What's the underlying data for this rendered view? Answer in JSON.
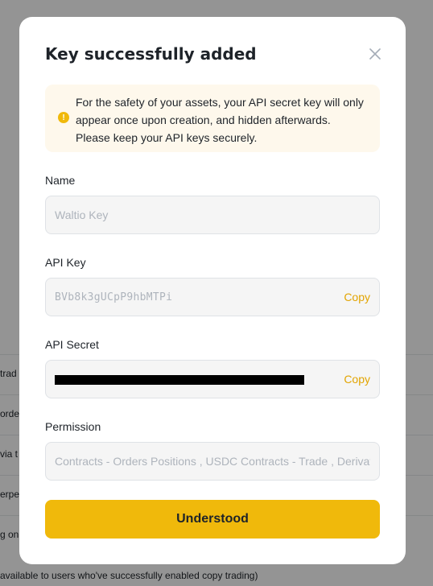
{
  "background": {
    "rows": [
      {
        "text": "trad"
      },
      {
        "text": "order"
      },
      {
        "text": "via t"
      },
      {
        "text": "erpe"
      },
      {
        "text": "g onl"
      }
    ],
    "bottom_note": "available to users who've successfully enabled copy trading)"
  },
  "modal": {
    "title": "Key successfully added",
    "close_icon": "close-icon",
    "notice": {
      "icon": "warning-icon",
      "color": "#f0b90b",
      "text": "For the safety of your assets, your API secret key will only\nappear once upon creation, and hidden afterwards.\nPlease keep your API keys securely."
    },
    "name": {
      "label": "Name",
      "value": "Waltio Key"
    },
    "api_key": {
      "label": "API Key",
      "value": "BVb8k3gUCpP9hbMTPi",
      "copy_label": "Copy"
    },
    "api_secret": {
      "label": "API Secret",
      "copy_label": "Copy"
    },
    "permission": {
      "label": "Permission",
      "value": "Contracts - Orders Positions  , USDC Contracts - Trade  , Derivatives"
    },
    "confirm_label": "Understood",
    "accent_color": "#f0b90b"
  }
}
